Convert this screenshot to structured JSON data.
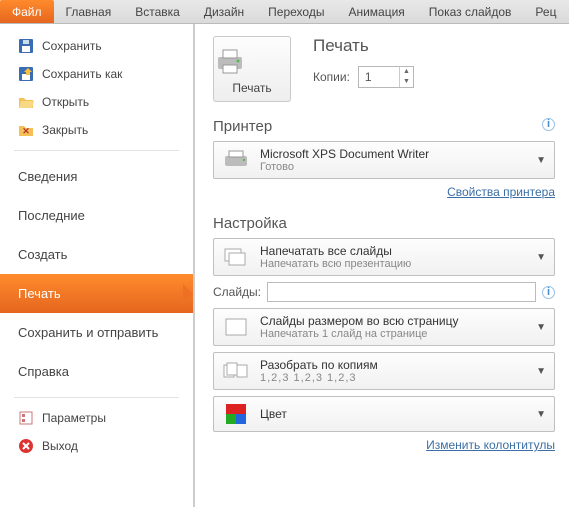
{
  "ribbon": {
    "tabs": [
      "Файл",
      "Главная",
      "Вставка",
      "Дизайн",
      "Переходы",
      "Анимация",
      "Показ слайдов",
      "Рец"
    ],
    "active": 0
  },
  "sidebar": {
    "save": "Сохранить",
    "saveas": "Сохранить как",
    "open": "Открыть",
    "close": "Закрыть",
    "info": "Сведения",
    "recent": "Последние",
    "new": "Создать",
    "print": "Печать",
    "send": "Сохранить и отправить",
    "help": "Справка",
    "options": "Параметры",
    "exit": "Выход"
  },
  "print": {
    "title": "Печать",
    "button": "Печать",
    "copies_label": "Копии:",
    "copies_value": "1"
  },
  "printer": {
    "heading": "Принтер",
    "name": "Microsoft XPS Document Writer",
    "status": "Готово",
    "props_link": "Свойства принтера"
  },
  "settings": {
    "heading": "Настройка",
    "range_main": "Напечатать все слайды",
    "range_sub": "Напечатать всю презентацию",
    "slides_label": "Слайды:",
    "slides_value": "",
    "layout_main": "Слайды размером во всю страницу",
    "layout_sub": "Напечатать 1 слайд на странице",
    "collate_main": "Разобрать по копиям",
    "collate_sub": "1,2,3    1,2,3    1,2,3",
    "color_main": "Цвет",
    "footer_link": "Изменить колонтитулы"
  }
}
